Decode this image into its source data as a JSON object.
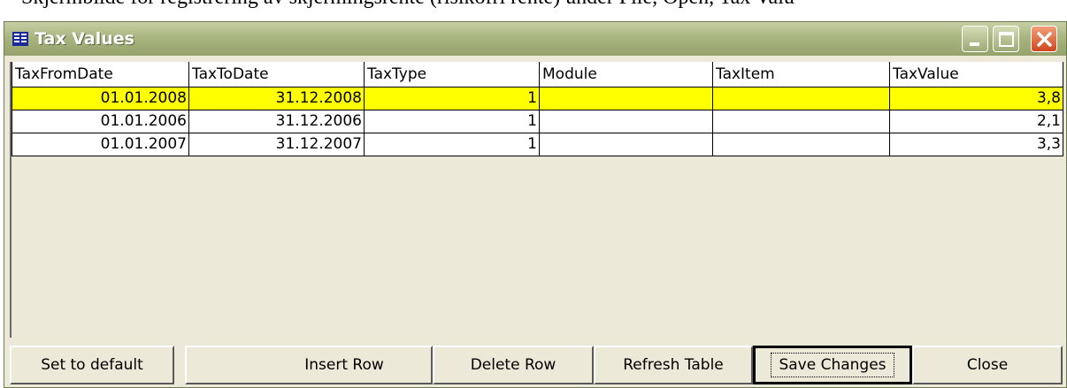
{
  "document": {
    "text_fragment": "Skjermbilde for registrering av skjermingsrente (risikofri rente) under File, Open, Tax Valu"
  },
  "window": {
    "title": "Tax Values",
    "icon": "table-window-icon",
    "controls": [
      "minimize-icon",
      "maximize-icon",
      "close-icon"
    ]
  },
  "table": {
    "columns": [
      "TaxFromDate",
      "TaxToDate",
      "TaxType",
      "Module",
      "TaxItem",
      "TaxValue"
    ],
    "rows": [
      {
        "from": "01.01.2008",
        "to": "31.12.2008",
        "type": "1",
        "module": "",
        "item": "",
        "value": "3,8",
        "selected": true
      },
      {
        "from": "01.01.2006",
        "to": "31.12.2006",
        "type": "1",
        "module": "",
        "item": "",
        "value": "2,1",
        "selected": false
      },
      {
        "from": "01.01.2007",
        "to": "31.12.2007",
        "type": "1",
        "module": "",
        "item": "",
        "value": "3,3",
        "selected": false
      }
    ]
  },
  "buttons": {
    "set_default": "Set to default",
    "insert_row": "Insert Row",
    "delete_row": "Delete Row",
    "refresh_table": "Refresh Table",
    "save_changes": "Save Changes",
    "close": "Close"
  },
  "colors": {
    "selected_row": "#ffff00",
    "titlebar": "#a9b580",
    "window_bg": "#ece9d8"
  }
}
